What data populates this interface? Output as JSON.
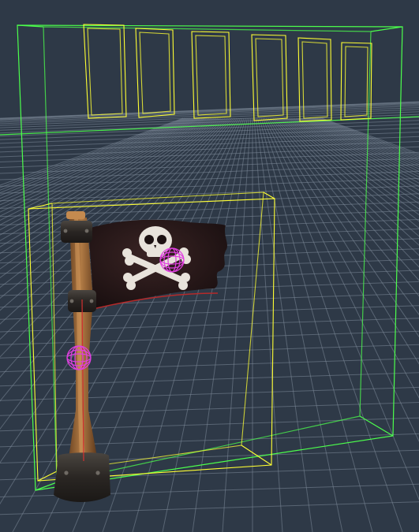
{
  "viewport": {
    "background_color": "#2e3947",
    "grid_color": "#7d8a99"
  },
  "scene": {
    "objects": [
      {
        "name": "wall-panel",
        "kind": "collision-bounds",
        "outline_color": "#4cff4c"
      },
      {
        "name": "window-1",
        "kind": "trigger-bounds",
        "outline_color": "#ffff33"
      },
      {
        "name": "window-2",
        "kind": "trigger-bounds",
        "outline_color": "#ffff33"
      },
      {
        "name": "window-3",
        "kind": "trigger-bounds",
        "outline_color": "#ffff33"
      },
      {
        "name": "window-4",
        "kind": "trigger-bounds",
        "outline_color": "#ffff33"
      },
      {
        "name": "window-5",
        "kind": "trigger-bounds",
        "outline_color": "#ffff33"
      },
      {
        "name": "window-6",
        "kind": "trigger-bounds",
        "outline_color": "#ffff33"
      },
      {
        "name": "flag-bounds",
        "kind": "selection-bounds",
        "outline_color": "#ffff33"
      },
      {
        "name": "pirate-flag",
        "kind": "mesh",
        "outline_color": ""
      },
      {
        "name": "flag-pole",
        "kind": "mesh",
        "outline_color": ""
      }
    ],
    "gizmos": [
      {
        "name": "flag-cloth-gizmo",
        "kind": "sphere",
        "color": "#e040e0"
      },
      {
        "name": "pole-gizmo",
        "kind": "sphere",
        "color": "#e040e0"
      }
    ]
  }
}
